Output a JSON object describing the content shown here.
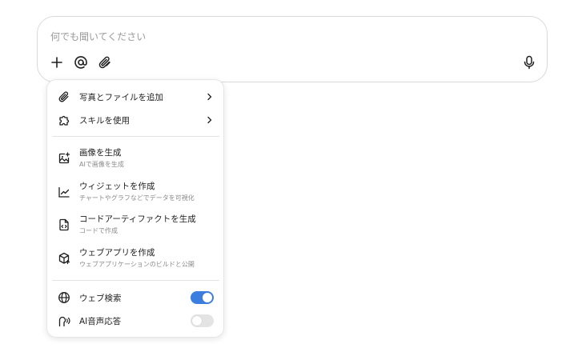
{
  "composer": {
    "placeholder": "何でも聞いてください"
  },
  "menu": {
    "items": [
      {
        "label": "写真とファイルを追加",
        "icon": "paperclip-icon"
      },
      {
        "label": "スキルを使用",
        "icon": "puzzle-icon"
      },
      {
        "label": "画像を生成",
        "sub": "AIで画像を生成",
        "icon": "image-plus-icon"
      },
      {
        "label": "ウィジェットを作成",
        "sub": "チャートやグラフなどでデータを可視化",
        "icon": "line-chart-icon"
      },
      {
        "label": "コードアーティファクトを生成",
        "sub": "コードで作成",
        "icon": "code-file-icon"
      },
      {
        "label": "ウェブアプリを作成",
        "sub": "ウェブアプリケーションのビルドと公開",
        "icon": "package-plus-icon"
      },
      {
        "label": "ウェブ検索",
        "icon": "globe-icon",
        "toggle": true
      },
      {
        "label": "AI音声応答",
        "icon": "voice-icon",
        "toggle": false
      }
    ]
  },
  "colors": {
    "accent": "#3b7ee0",
    "border": "#d9d9d9"
  }
}
